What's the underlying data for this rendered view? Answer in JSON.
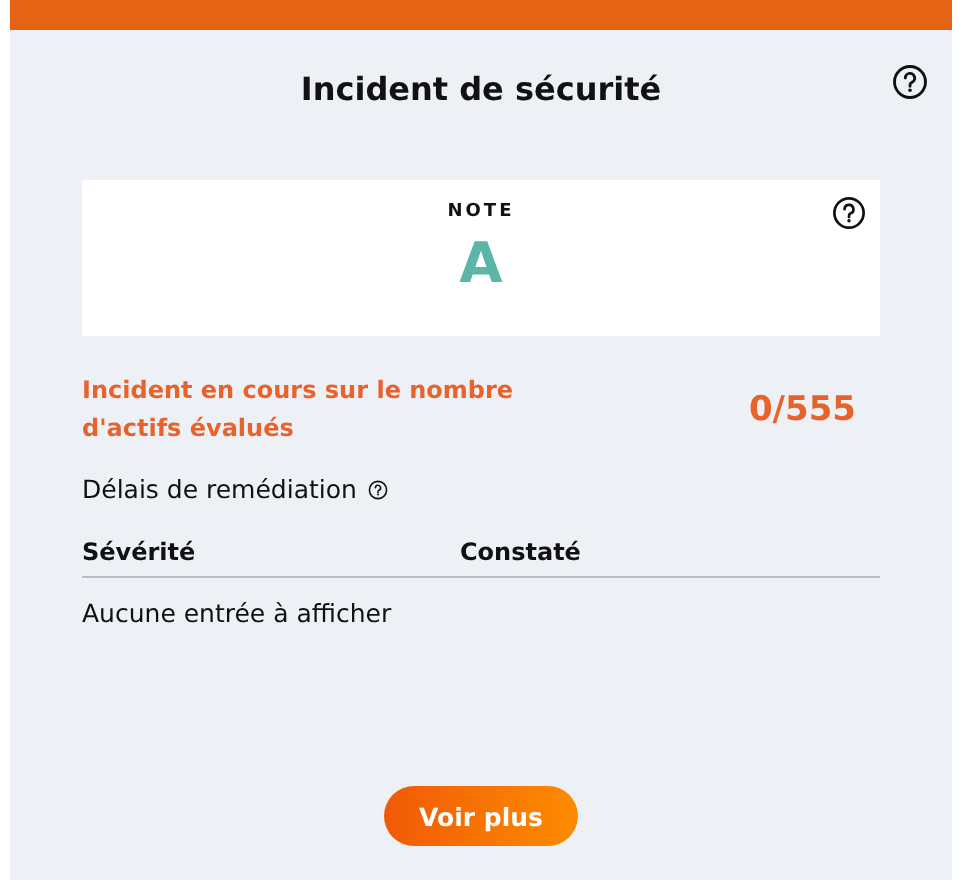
{
  "card": {
    "title": "Incident de sécurité",
    "note": {
      "label": "NOTE",
      "grade": "A"
    },
    "incident": {
      "label": "Incident en cours sur le nombre d'actifs évalués",
      "count": "0/555"
    },
    "remediation": {
      "title": "Délais de remédiation"
    },
    "table": {
      "columns": [
        "Sévérité",
        "Constaté"
      ],
      "empty": "Aucune entrée à afficher"
    },
    "button": "Voir plus"
  }
}
